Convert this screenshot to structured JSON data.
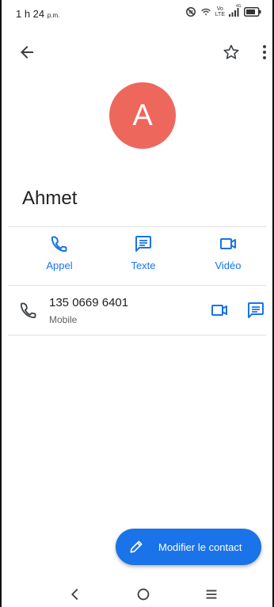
{
  "status_bar": {
    "time": "1 h 24",
    "time_suffix": "p.m.",
    "volte_top": "Vo",
    "volte_bottom": "LTE",
    "signal_label": "4G"
  },
  "contact": {
    "avatar_initial": "A",
    "name": "Ahmet"
  },
  "actions": [
    {
      "label": "Appel",
      "icon": "phone-icon"
    },
    {
      "label": "Texte",
      "icon": "message-icon"
    },
    {
      "label": "Vidéo",
      "icon": "video-icon"
    }
  ],
  "phone": {
    "number": "135 0669 6401",
    "type": "Mobile"
  },
  "fab": {
    "label": "Modifier le contact",
    "icon": "pencil-icon"
  },
  "colors": {
    "accent": "#1a73e8",
    "avatar_bg": "#ee675c"
  }
}
